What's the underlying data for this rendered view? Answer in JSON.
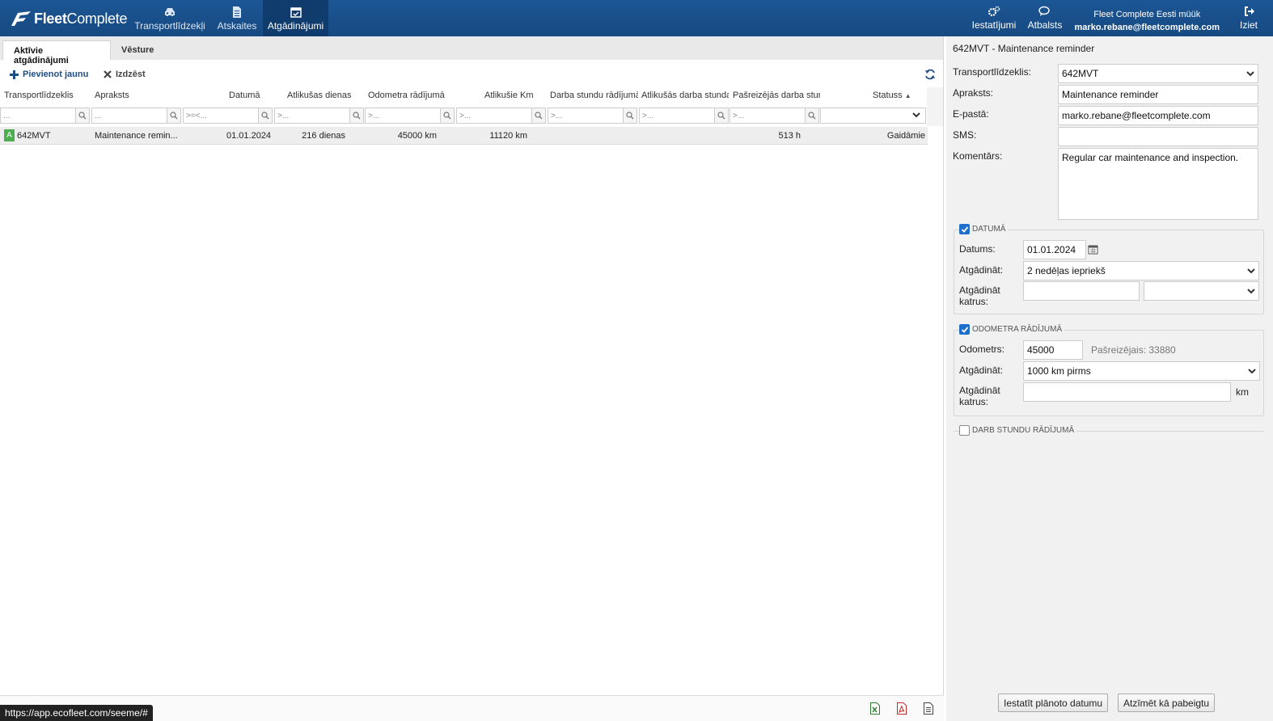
{
  "nav": {
    "logo_part1": "Fleet",
    "logo_part2": "Complete",
    "items": [
      {
        "label": "Transportlīdzekļi",
        "icon": "car-icon"
      },
      {
        "label": "Atskaites",
        "icon": "document-icon"
      },
      {
        "label": "Atgādinājumi",
        "icon": "calendar-icon"
      }
    ],
    "settings_label": "Iestatījumi",
    "support_label": "Atbalsts",
    "company": "Fleet Complete Eesti müük",
    "user_email": "marko.rebane@fleetcomplete.com",
    "logout_label": "Iziet"
  },
  "tabs": [
    {
      "label": "Aktīvie atgādinājumi",
      "active": true
    },
    {
      "label": "Vēsture",
      "active": false
    }
  ],
  "toolbar": {
    "add_label": "Pievienot jaunu",
    "delete_label": "Izdzēst"
  },
  "grid": {
    "columns": [
      "Transportlīdzeklis",
      "Apraksts",
      "Datumā",
      "Atlikušas dienas",
      "Odometra rādījumā",
      "Atlikušie Km",
      "Darba stundu rādījumā",
      "Atlikušās darba stundas",
      "Pašreizējās darba stundas",
      "Statuss"
    ],
    "filter_placeholders": [
      "...",
      "...",
      ">=<...",
      ">...",
      ">...",
      ">...",
      ">...",
      ">...",
      ">...",
      ""
    ],
    "rows": [
      {
        "badge": "A",
        "vehicle": "642MVT",
        "description": "Maintenance remin...",
        "date": "01.01.2024",
        "days_left": "216 dienas",
        "odometer": "45000 km",
        "km_left": "11120 km",
        "engine_hours": "",
        "hours_left": "",
        "current_hours": "513 h",
        "status": "Gaidāmie"
      }
    ]
  },
  "status_url": "https://app.ecofleet.com/seeme/#",
  "detail": {
    "title": "642MVT - Maintenance reminder",
    "vehicle_label": "Transportlīdzeklis:",
    "vehicle_value": "642MVT",
    "description_label": "Apraksts:",
    "description_value": "Maintenance reminder",
    "email_label": "E-pastā:",
    "email_value": "marko.rebane@fleetcomplete.com",
    "sms_label": "SMS:",
    "sms_value": "",
    "comment_label": "Komentārs:",
    "comment_value": "Regular car maintenance and inspection.",
    "date_section": {
      "legend": "DATUMĀ",
      "checked": true,
      "date_label": "Datums:",
      "date_value": "01.01.2024",
      "remind_label": "Atgādināt:",
      "remind_value": "2 nedēļas iepriekš",
      "repeat_label_1": "Atgādināt",
      "repeat_label_2": "katrus:",
      "repeat_value": ""
    },
    "odometer_section": {
      "legend": "ODOMETRA RĀDĪJUMĀ",
      "checked": true,
      "odometer_label": "Odometrs:",
      "odometer_value": "45000",
      "current_text": "Pašreizējais: 33880",
      "remind_label": "Atgādināt:",
      "remind_value": "1000 km pirms",
      "repeat_label_1": "Atgādināt",
      "repeat_label_2": "katrus:",
      "repeat_value": "",
      "unit": "km"
    },
    "hours_section": {
      "legend": "DARB STUNDU RĀDĪJUMĀ",
      "checked": false
    },
    "set_date_button": "Iestatīt plānoto datumu",
    "mark_done_button": "Atzīmēt kā pabeigtu"
  }
}
